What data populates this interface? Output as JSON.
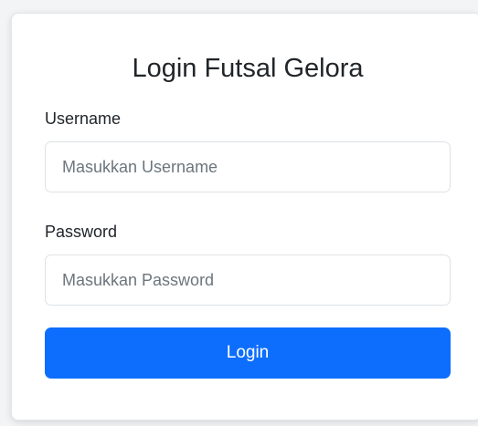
{
  "form": {
    "title": "Login Futsal Gelora",
    "username": {
      "label": "Username",
      "placeholder": "Masukkan Username",
      "value": ""
    },
    "password": {
      "label": "Password",
      "placeholder": "Masukkan Password",
      "value": ""
    },
    "submit_label": "Login"
  },
  "colors": {
    "primary": "#0d6efd",
    "text": "#212529",
    "placeholder": "#6c757d",
    "border": "#dee2e6",
    "page_background": "#f3f4f6"
  }
}
